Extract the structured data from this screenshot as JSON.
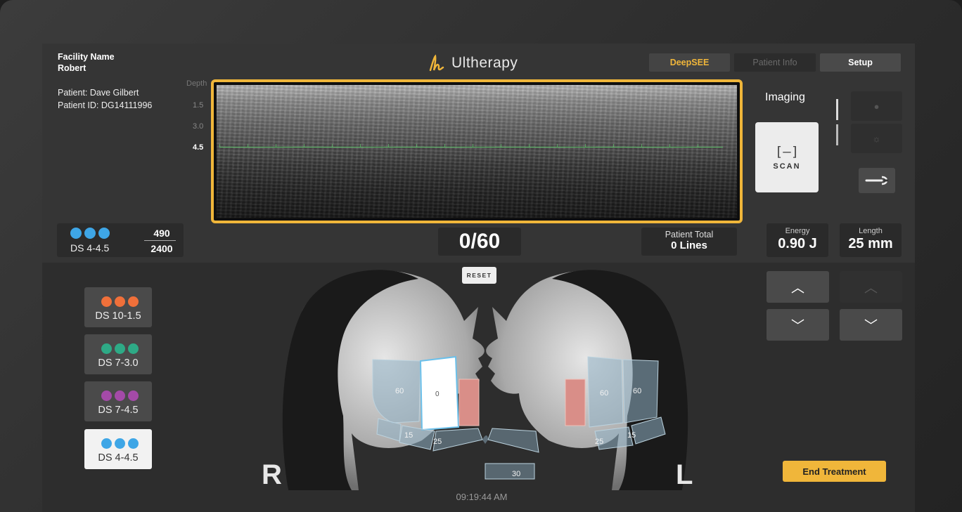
{
  "header": {
    "facility_name": "Facility Name",
    "operator": "Robert",
    "patient": "Patient: Dave Gilbert",
    "patient_id": "Patient ID: DG14111996",
    "logo_text": "Ultherapy",
    "brand_color": "#f0b63a"
  },
  "tabs": [
    {
      "label": "DeepSEE",
      "state": "active"
    },
    {
      "label": "Patient Info",
      "state": "disabled"
    },
    {
      "label": "Setup",
      "state": "enabled"
    }
  ],
  "imaging": {
    "depth_header": "Depth",
    "depth_ticks": [
      "1.5",
      "3.0",
      "4.5"
    ],
    "active_depth": "4.5",
    "label": "Imaging",
    "scan_icon": "[–]",
    "scan_label": "SCAN",
    "brightness_up_icon": "brightness-high-icon",
    "brightness_down_icon": "brightness-low-icon",
    "settings_icon": "wrench-icon"
  },
  "transducer": {
    "label": "DS 4-4.5",
    "dot_color": "#3ea6e6",
    "lines_used": "490",
    "lines_total": "2400"
  },
  "counter": {
    "value": "0/60",
    "reset_label": "RESET"
  },
  "patient_total": {
    "title": "Patient Total",
    "value": "0 Lines"
  },
  "params": {
    "energy_label": "Energy",
    "energy_value": "0.90 J",
    "length_label": "Length",
    "length_value": "25 mm"
  },
  "transducers": [
    {
      "label": "DS 10-1.5",
      "color": "#f0703a",
      "selected": false
    },
    {
      "label": "DS 7-3.0",
      "color": "#2eaa86",
      "selected": false
    },
    {
      "label": "DS 7-4.5",
      "color": "#a44aa8",
      "selected": false
    },
    {
      "label": "DS 4-4.5",
      "color": "#3ea6e6",
      "selected": true
    }
  ],
  "zones": {
    "right_zone_60": "60",
    "right_zone_active": "0",
    "right_15": "15",
    "right_25": "25",
    "center_30": "30",
    "left_60_a": "60",
    "left_60_b": "60",
    "left_25": "25",
    "left_15": "15"
  },
  "sides": {
    "right": "R",
    "left": "L"
  },
  "end_treatment": "End Treatment",
  "clock": "09:19:44 AM"
}
